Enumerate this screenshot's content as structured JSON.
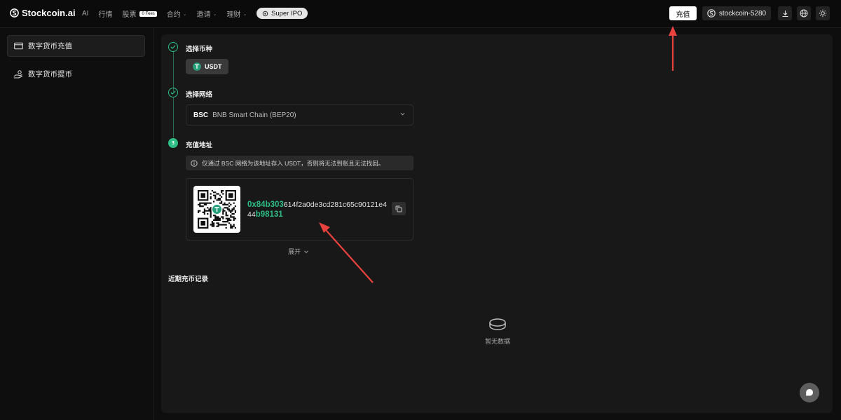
{
  "header": {
    "logo_text": "Stockcoin.ai",
    "nav": [
      {
        "label": "AI"
      },
      {
        "label": "行情"
      },
      {
        "label": "股票",
        "badge": "0 Fees"
      },
      {
        "label": "合约",
        "dropdown": true
      },
      {
        "label": "邀请",
        "dropdown": true
      },
      {
        "label": "理财",
        "dropdown": true
      }
    ],
    "ipo_label": "Super IPO",
    "recharge_label": "充值",
    "account_label": "stockcoin-5280"
  },
  "sidebar": {
    "items": [
      {
        "label": "数字货币充值",
        "icon": "wallet-icon",
        "active": true
      },
      {
        "label": "数字货币提币",
        "icon": "hand-coin-icon",
        "active": false
      }
    ]
  },
  "main": {
    "steps": [
      {
        "title": "选择币种",
        "state": "done"
      },
      {
        "title": "选择网络",
        "state": "done"
      },
      {
        "title": "充值地址",
        "state": "active",
        "number": "3"
      }
    ],
    "coin": "USDT",
    "network": {
      "code": "BSC",
      "name": "BNB Smart Chain (BEP20)"
    },
    "notice": "仅通过 BSC 网络为该地址存入 USDT，否则将无法到账且无法找回。",
    "address": {
      "start": "0x84b303",
      "middle": "614f2a0de3cd281c65c90121e444",
      "end": "b98131"
    },
    "expand_label": "展开",
    "records_title": "近期充币记录",
    "empty_label": "暂无数据"
  },
  "colors": {
    "accent": "#2dbd85",
    "annotation": "#e8423f"
  }
}
